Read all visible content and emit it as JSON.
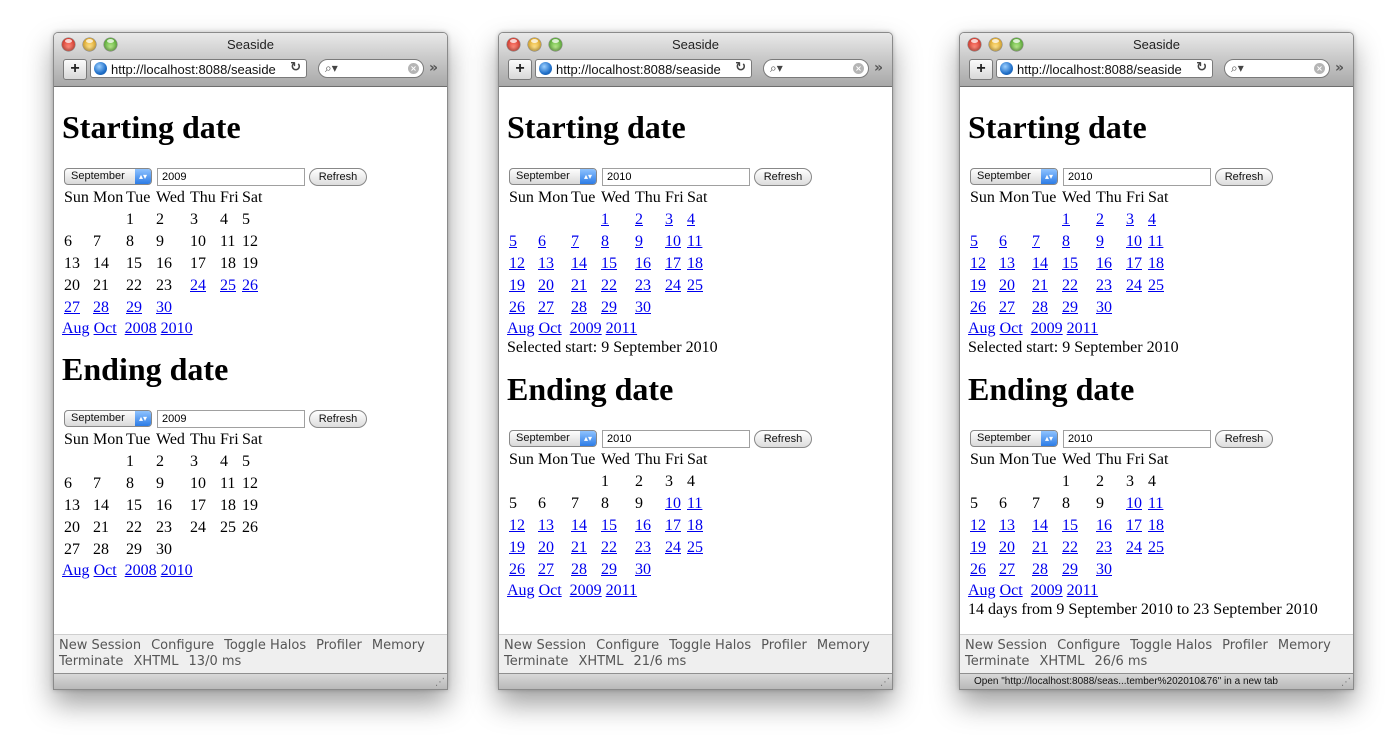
{
  "days_header": [
    "Sun",
    "Mon",
    "Tue",
    "Wed",
    "Thu",
    "Fri",
    "Sat"
  ],
  "windows": [
    {
      "title": "Seaside",
      "url": "http://localhost:8088/seaside",
      "status_text": "",
      "footer": {
        "items1": [
          "New Session",
          "Configure",
          "Toggle Halos",
          "Profiler",
          "Memory"
        ],
        "items2": [
          "Terminate",
          "XHTML",
          "13/0 ms"
        ]
      },
      "sections": [
        {
          "heading": "Starting date",
          "month": "September",
          "year": "2009",
          "refresh": "Refresh",
          "weeks": [
            [
              [
                "",
                0
              ],
              [
                "",
                0
              ],
              [
                "1",
                0
              ],
              [
                "2",
                0
              ],
              [
                "3",
                0
              ],
              [
                "4",
                0
              ],
              [
                "5",
                0
              ]
            ],
            [
              [
                "6",
                0
              ],
              [
                "7",
                0
              ],
              [
                "8",
                0
              ],
              [
                "9",
                0
              ],
              [
                "10",
                0
              ],
              [
                "11",
                0
              ],
              [
                "12",
                0
              ]
            ],
            [
              [
                "13",
                0
              ],
              [
                "14",
                0
              ],
              [
                "15",
                0
              ],
              [
                "16",
                0
              ],
              [
                "17",
                0
              ],
              [
                "18",
                0
              ],
              [
                "19",
                0
              ]
            ],
            [
              [
                "20",
                0
              ],
              [
                "21",
                0
              ],
              [
                "22",
                0
              ],
              [
                "23",
                0
              ],
              [
                "24",
                1
              ],
              [
                "25",
                1
              ],
              [
                "26",
                1
              ]
            ],
            [
              [
                "27",
                1
              ],
              [
                "28",
                1
              ],
              [
                "29",
                1
              ],
              [
                "30",
                1
              ],
              [
                "",
                0
              ],
              [
                "",
                0
              ],
              [
                "",
                0
              ]
            ]
          ],
          "nav": [
            "Aug",
            "Oct",
            "2008",
            "2010"
          ],
          "after": ""
        },
        {
          "heading": "Ending date",
          "month": "September",
          "year": "2009",
          "refresh": "Refresh",
          "weeks": [
            [
              [
                "",
                0
              ],
              [
                "",
                0
              ],
              [
                "1",
                0
              ],
              [
                "2",
                0
              ],
              [
                "3",
                0
              ],
              [
                "4",
                0
              ],
              [
                "5",
                0
              ]
            ],
            [
              [
                "6",
                0
              ],
              [
                "7",
                0
              ],
              [
                "8",
                0
              ],
              [
                "9",
                0
              ],
              [
                "10",
                0
              ],
              [
                "11",
                0
              ],
              [
                "12",
                0
              ]
            ],
            [
              [
                "13",
                0
              ],
              [
                "14",
                0
              ],
              [
                "15",
                0
              ],
              [
                "16",
                0
              ],
              [
                "17",
                0
              ],
              [
                "18",
                0
              ],
              [
                "19",
                0
              ]
            ],
            [
              [
                "20",
                0
              ],
              [
                "21",
                0
              ],
              [
                "22",
                0
              ],
              [
                "23",
                0
              ],
              [
                "24",
                0
              ],
              [
                "25",
                0
              ],
              [
                "26",
                0
              ]
            ],
            [
              [
                "27",
                0
              ],
              [
                "28",
                0
              ],
              [
                "29",
                0
              ],
              [
                "30",
                0
              ],
              [
                "",
                0
              ],
              [
                "",
                0
              ],
              [
                "",
                0
              ]
            ]
          ],
          "nav": [
            "Aug",
            "Oct",
            "2008",
            "2010"
          ],
          "after": ""
        }
      ]
    },
    {
      "title": "Seaside",
      "url": "http://localhost:8088/seaside",
      "status_text": "",
      "footer": {
        "items1": [
          "New Session",
          "Configure",
          "Toggle Halos",
          "Profiler",
          "Memory"
        ],
        "items2": [
          "Terminate",
          "XHTML",
          "21/6 ms"
        ]
      },
      "sections": [
        {
          "heading": "Starting date",
          "month": "September",
          "year": "2010",
          "refresh": "Refresh",
          "weeks": [
            [
              [
                "",
                0
              ],
              [
                "",
                0
              ],
              [
                "",
                0
              ],
              [
                "1",
                1
              ],
              [
                "2",
                1
              ],
              [
                "3",
                1
              ],
              [
                "4",
                1
              ]
            ],
            [
              [
                "5",
                1
              ],
              [
                "6",
                1
              ],
              [
                "7",
                1
              ],
              [
                "8",
                1
              ],
              [
                "9",
                1
              ],
              [
                "10",
                1
              ],
              [
                "11",
                1
              ]
            ],
            [
              [
                "12",
                1
              ],
              [
                "13",
                1
              ],
              [
                "14",
                1
              ],
              [
                "15",
                1
              ],
              [
                "16",
                1
              ],
              [
                "17",
                1
              ],
              [
                "18",
                1
              ]
            ],
            [
              [
                "19",
                1
              ],
              [
                "20",
                1
              ],
              [
                "21",
                1
              ],
              [
                "22",
                1
              ],
              [
                "23",
                1
              ],
              [
                "24",
                1
              ],
              [
                "25",
                1
              ]
            ],
            [
              [
                "26",
                1
              ],
              [
                "27",
                1
              ],
              [
                "28",
                1
              ],
              [
                "29",
                1
              ],
              [
                "30",
                1
              ],
              [
                "",
                0
              ],
              [
                "",
                0
              ]
            ]
          ],
          "nav": [
            "Aug",
            "Oct",
            "2009",
            "2011"
          ],
          "after": "Selected start: 9 September 2010"
        },
        {
          "heading": "Ending date",
          "month": "September",
          "year": "2010",
          "refresh": "Refresh",
          "weeks": [
            [
              [
                "",
                0
              ],
              [
                "",
                0
              ],
              [
                "",
                0
              ],
              [
                "1",
                0
              ],
              [
                "2",
                0
              ],
              [
                "3",
                0
              ],
              [
                "4",
                0
              ]
            ],
            [
              [
                "5",
                0
              ],
              [
                "6",
                0
              ],
              [
                "7",
                0
              ],
              [
                "8",
                0
              ],
              [
                "9",
                0
              ],
              [
                "10",
                1
              ],
              [
                "11",
                1
              ]
            ],
            [
              [
                "12",
                1
              ],
              [
                "13",
                1
              ],
              [
                "14",
                1
              ],
              [
                "15",
                1
              ],
              [
                "16",
                1
              ],
              [
                "17",
                1
              ],
              [
                "18",
                1
              ]
            ],
            [
              [
                "19",
                1
              ],
              [
                "20",
                1
              ],
              [
                "21",
                1
              ],
              [
                "22",
                1
              ],
              [
                "23",
                1
              ],
              [
                "24",
                1
              ],
              [
                "25",
                1
              ]
            ],
            [
              [
                "26",
                1
              ],
              [
                "27",
                1
              ],
              [
                "28",
                1
              ],
              [
                "29",
                1
              ],
              [
                "30",
                1
              ],
              [
                "",
                0
              ],
              [
                "",
                0
              ]
            ]
          ],
          "nav": [
            "Aug",
            "Oct",
            "2009",
            "2011"
          ],
          "after": ""
        }
      ]
    },
    {
      "title": "Seaside",
      "url": "http://localhost:8088/seaside",
      "status_text": "Open \"http://localhost:8088/seas...tember%202010&76\" in a new tab",
      "footer": {
        "items1": [
          "New Session",
          "Configure",
          "Toggle Halos",
          "Profiler",
          "Memory"
        ],
        "items2": [
          "Terminate",
          "XHTML",
          "26/6 ms"
        ]
      },
      "sections": [
        {
          "heading": "Starting date",
          "month": "September",
          "year": "2010",
          "refresh": "Refresh",
          "weeks": [
            [
              [
                "",
                0
              ],
              [
                "",
                0
              ],
              [
                "",
                0
              ],
              [
                "1",
                1
              ],
              [
                "2",
                1
              ],
              [
                "3",
                1
              ],
              [
                "4",
                1
              ]
            ],
            [
              [
                "5",
                1
              ],
              [
                "6",
                1
              ],
              [
                "7",
                1
              ],
              [
                "8",
                1
              ],
              [
                "9",
                1
              ],
              [
                "10",
                1
              ],
              [
                "11",
                1
              ]
            ],
            [
              [
                "12",
                1
              ],
              [
                "13",
                1
              ],
              [
                "14",
                1
              ],
              [
                "15",
                1
              ],
              [
                "16",
                1
              ],
              [
                "17",
                1
              ],
              [
                "18",
                1
              ]
            ],
            [
              [
                "19",
                1
              ],
              [
                "20",
                1
              ],
              [
                "21",
                1
              ],
              [
                "22",
                1
              ],
              [
                "23",
                1
              ],
              [
                "24",
                1
              ],
              [
                "25",
                1
              ]
            ],
            [
              [
                "26",
                1
              ],
              [
                "27",
                1
              ],
              [
                "28",
                1
              ],
              [
                "29",
                1
              ],
              [
                "30",
                1
              ],
              [
                "",
                0
              ],
              [
                "",
                0
              ]
            ]
          ],
          "nav": [
            "Aug",
            "Oct",
            "2009",
            "2011"
          ],
          "after": "Selected start: 9 September 2010"
        },
        {
          "heading": "Ending date",
          "month": "September",
          "year": "2010",
          "refresh": "Refresh",
          "weeks": [
            [
              [
                "",
                0
              ],
              [
                "",
                0
              ],
              [
                "",
                0
              ],
              [
                "1",
                0
              ],
              [
                "2",
                0
              ],
              [
                "3",
                0
              ],
              [
                "4",
                0
              ]
            ],
            [
              [
                "5",
                0
              ],
              [
                "6",
                0
              ],
              [
                "7",
                0
              ],
              [
                "8",
                0
              ],
              [
                "9",
                0
              ],
              [
                "10",
                1
              ],
              [
                "11",
                1
              ]
            ],
            [
              [
                "12",
                1
              ],
              [
                "13",
                1
              ],
              [
                "14",
                1
              ],
              [
                "15",
                1
              ],
              [
                "16",
                1
              ],
              [
                "17",
                1
              ],
              [
                "18",
                1
              ]
            ],
            [
              [
                "19",
                1
              ],
              [
                "20",
                1
              ],
              [
                "21",
                1
              ],
              [
                "22",
                1
              ],
              [
                "23",
                1
              ],
              [
                "24",
                1
              ],
              [
                "25",
                1
              ]
            ],
            [
              [
                "26",
                1
              ],
              [
                "27",
                1
              ],
              [
                "28",
                1
              ],
              [
                "29",
                1
              ],
              [
                "30",
                1
              ],
              [
                "",
                0
              ],
              [
                "",
                0
              ]
            ]
          ],
          "nav": [
            "Aug",
            "Oct",
            "2009",
            "2011"
          ],
          "after": "14 days from 9 September 2010 to 23 September 2010"
        }
      ]
    }
  ]
}
